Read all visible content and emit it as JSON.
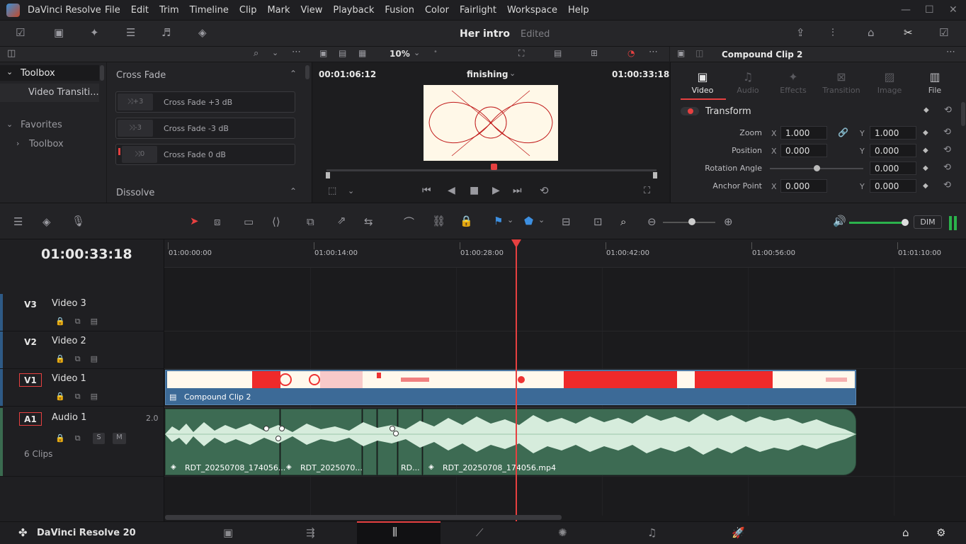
{
  "app": {
    "name": "DaVinci Resolve",
    "brand": "DaVinci Resolve 20"
  },
  "menu": [
    "File",
    "Edit",
    "Trim",
    "Timeline",
    "Clip",
    "Mark",
    "View",
    "Playback",
    "Fusion",
    "Color",
    "Fairlight",
    "Workspace",
    "Help"
  ],
  "project": {
    "title": "Her intro",
    "status": "Edited"
  },
  "effects": {
    "tree": {
      "toolbox": "Toolbox",
      "video_transitions": "Video Transiti...",
      "favorites": "Favorites",
      "fav_toolbox": "Toolbox"
    },
    "section1": "Cross Fade",
    "items": [
      "Cross Fade +3 dB",
      "Cross Fade -3 dB",
      "Cross Fade 0 dB"
    ],
    "section2": "Dissolve"
  },
  "viewer": {
    "zoom": "10%",
    "source_tc": "00:01:06:12",
    "timeline_name": "finishing",
    "record_tc": "01:00:33:18"
  },
  "inspector": {
    "clip_name": "Compound Clip 2",
    "tabs": [
      "Video",
      "Audio",
      "Effects",
      "Transition",
      "Image",
      "File"
    ],
    "section": "Transform",
    "rows": [
      {
        "label": "Zoom",
        "x": "1.000",
        "y": "1.000"
      },
      {
        "label": "Position",
        "x": "0.000",
        "y": "0.000"
      },
      {
        "label": "Rotation Angle",
        "value": "0.000"
      },
      {
        "label": "Anchor Point",
        "x": "0.000",
        "y": "0.000"
      }
    ],
    "axis_x": "X",
    "axis_y": "Y"
  },
  "timeline": {
    "timecode": "01:00:33:18",
    "ruler": [
      "01:00:00:00",
      "01:00:14:00",
      "01:00:28:00",
      "01:00:42:00",
      "01:00:56:00",
      "01:01:10:00"
    ],
    "dim": "DIM",
    "tracks": [
      {
        "id": "V3",
        "name": "Video 3"
      },
      {
        "id": "V2",
        "name": "Video 2"
      },
      {
        "id": "V1",
        "name": "Video 1"
      },
      {
        "id": "A1",
        "name": "Audio 1",
        "channels": "2.0",
        "clips": "6 Clips",
        "solo": "S",
        "mute": "M"
      }
    ],
    "video_clip": "Compound Clip 2",
    "audio_clips": [
      "RDT_20250708_174056...",
      "RDT_2025070...",
      "RD...",
      "RDT_20250708_174056.mp4"
    ]
  },
  "colors": {
    "accent": "#e64040",
    "video_clip": "#3c6a97",
    "audio_clip": "#3d6b53"
  }
}
